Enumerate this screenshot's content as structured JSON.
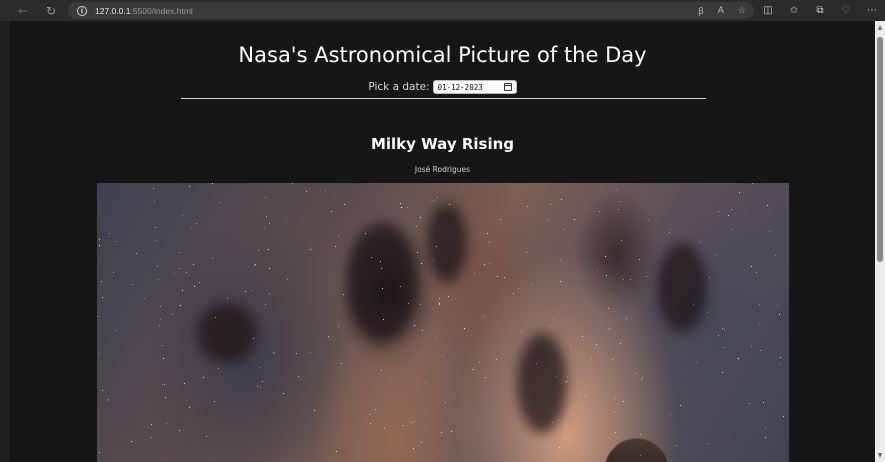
{
  "browser": {
    "url_host": "127.0.0.1",
    "url_path": ":5500/index.html",
    "icons": [
      "back-icon",
      "reload-icon",
      "info-icon",
      "read-aloud-icon",
      "text-size-icon",
      "favorite-star-icon",
      "split-screen-icon",
      "favorites-icon",
      "collections-icon",
      "health-heart-icon",
      "more-icon"
    ]
  },
  "page": {
    "title": "Nasa's Astronomical Picture of the Day",
    "date_label": "Pick a date:",
    "date_value": "01-12-2023"
  },
  "apod": {
    "title": "Milky Way Rising",
    "credit": "José Rodrigues"
  },
  "colors": {
    "page_background": "#161616",
    "text": "#ffffff",
    "health_icon": "#38c172"
  }
}
